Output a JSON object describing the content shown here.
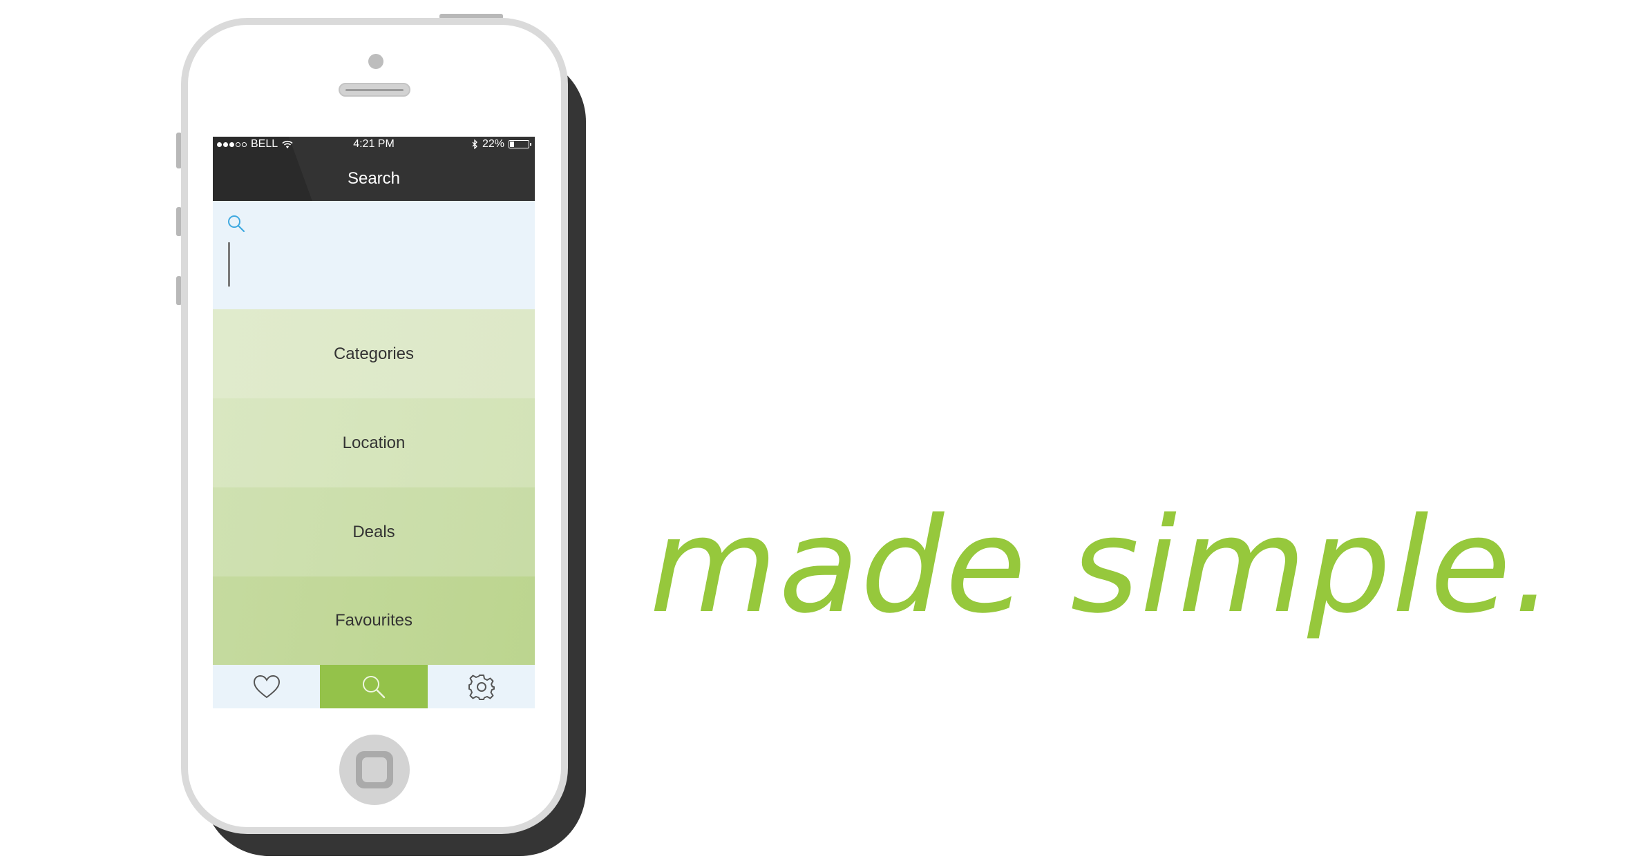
{
  "status_bar": {
    "carrier": "BELL",
    "time": "4:21 PM",
    "battery": "22%"
  },
  "header": {
    "title": "Search"
  },
  "search": {
    "value": "",
    "icon": "search-icon"
  },
  "menu": {
    "items": [
      {
        "label": "Categories"
      },
      {
        "label": "Location"
      },
      {
        "label": "Deals"
      },
      {
        "label": "Favourites"
      }
    ]
  },
  "tab_bar": {
    "tabs": [
      {
        "icon": "heart-icon",
        "active": false
      },
      {
        "icon": "search-icon",
        "active": true
      },
      {
        "icon": "gear-icon",
        "active": false
      }
    ]
  },
  "tagline": "made simple.",
  "colors": {
    "accent": "#96c83c",
    "active_tab": "#94c24a",
    "header": "#333333",
    "search_bg": "#eaf3fa"
  }
}
